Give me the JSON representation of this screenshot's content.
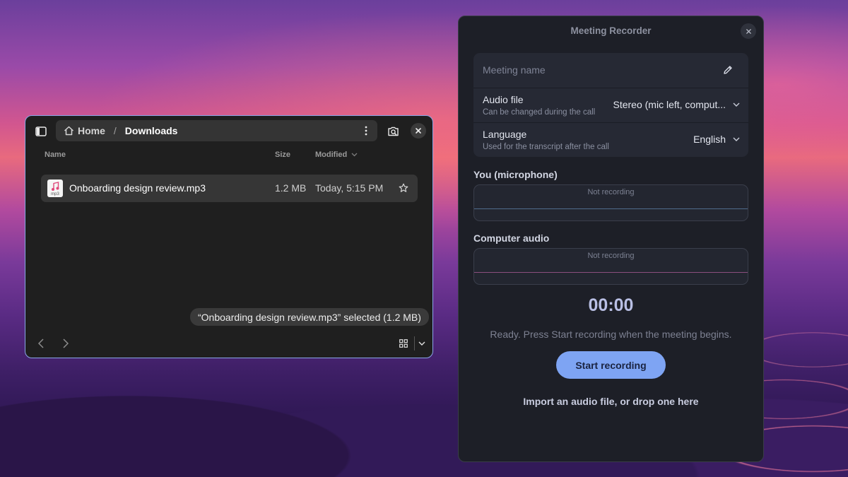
{
  "files_window": {
    "breadcrumb": {
      "home": "Home",
      "separator": "/",
      "current": "Downloads"
    },
    "columns": {
      "name": "Name",
      "size": "Size",
      "modified": "Modified"
    },
    "rows": [
      {
        "name": "Onboarding design review.mp3",
        "icon_ext": "mp3",
        "size": "1.2 MB",
        "modified": "Today, 5:15 PM"
      }
    ],
    "status": "“Onboarding design review.mp3” selected  (1.2 MB)",
    "icons": {
      "sidebar": "sidebar-icon",
      "home": "home-icon",
      "menu": "kebab-menu-icon",
      "search": "search-icon",
      "close": "close-icon",
      "star": "star-icon",
      "back": "chevron-left-icon",
      "forward": "chevron-right-icon",
      "grid": "grid-view-icon",
      "view_menu": "chevron-down-icon"
    },
    "accent": "#8aa6e8"
  },
  "recorder": {
    "title": "Meeting Recorder",
    "meeting_name_placeholder": "Meeting name",
    "audio_file": {
      "label": "Audio file",
      "sub": "Can be changed during the call",
      "value": "Stereo (mic left, comput..."
    },
    "language": {
      "label": "Language",
      "sub": "Used for the transcript after the call",
      "value": "English"
    },
    "mic_section": "You (microphone)",
    "mic_status": "Not recording",
    "computer_section": "Computer audio",
    "computer_status": "Not recording",
    "timer": "00:00",
    "status_message": "Ready. Press Start recording when the meeting begins.",
    "start_button": "Start recording",
    "import_link": "Import an audio file, or drop one here",
    "colors": {
      "button": "#7ea4f3",
      "timer": "#b9bfe4",
      "mic_line": "#4f6c8c",
      "computer_line": "#8a4f7e"
    }
  }
}
